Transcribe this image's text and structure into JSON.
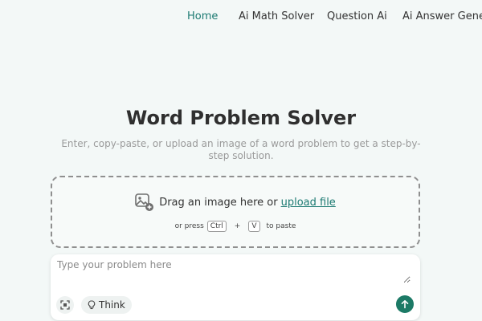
{
  "nav": {
    "items": [
      "Home",
      "Ai Math Solver",
      "Question Ai",
      "Ai Answer Generator"
    ],
    "active": "Home"
  },
  "hero": {
    "title": "Word Problem Solver",
    "subtitle": "Enter, copy-paste, or upload an image of a word problem to get a step-by-step solution."
  },
  "dropzone": {
    "prompt": "Drag an image here or",
    "upload_link": "upload file",
    "or_press": "or press",
    "key_ctrl": "Ctrl",
    "plus": "+",
    "key_v": "V",
    "to_paste": "to paste",
    "icon": "image-add-icon"
  },
  "input": {
    "placeholder": "Type your problem here",
    "think_label": "Think",
    "tool_icon": "scan-icon",
    "think_icon": "lightbulb-icon",
    "send_icon": "arrow-up-icon"
  },
  "colors": {
    "accent": "#1c7a72",
    "send_button": "#1c7a66",
    "background": "#f3f8f7"
  }
}
